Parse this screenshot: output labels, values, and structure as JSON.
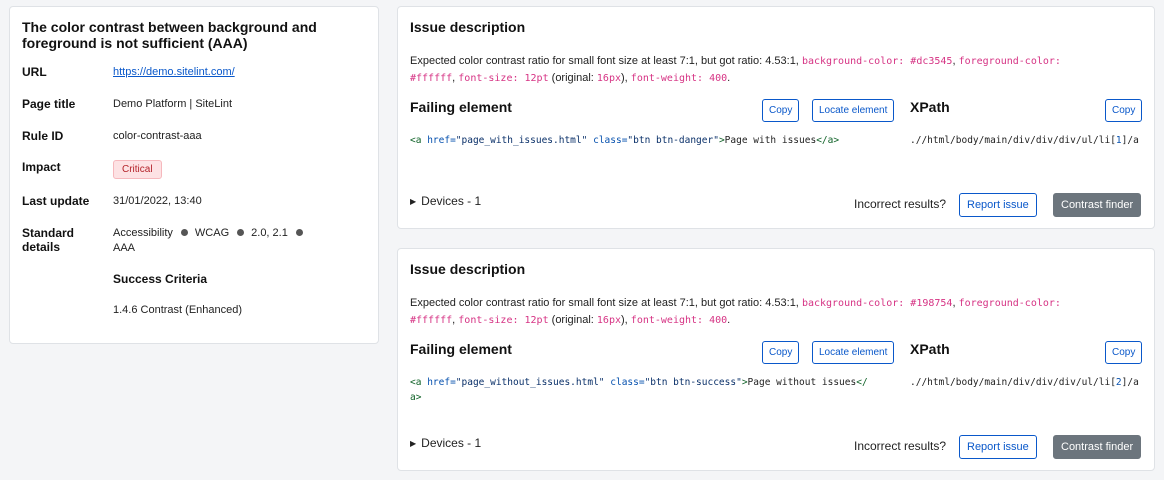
{
  "summary": {
    "title": "The color contrast between background and foreground is not sufficient (AAA)",
    "url_label": "URL",
    "url_value": "https://demo.sitelint.com/",
    "page_title_label": "Page title",
    "page_title_value": "Demo Platform | SiteLint",
    "rule_id_label": "Rule ID",
    "rule_id_value": "color-contrast-aaa",
    "impact_label": "Impact",
    "impact_value": "Critical",
    "last_update_label": "Last update",
    "last_update_value": "31/01/2022, 13:40",
    "standard_label": "Standard details",
    "standard_parts": [
      "Accessibility",
      "WCAG",
      "2.0, 2.1",
      "AAA"
    ],
    "success_criteria_label": "Success Criteria",
    "success_criteria_value": "1.4.6 Contrast (Enhanced)"
  },
  "issues": [
    {
      "heading": "Issue description",
      "desc_text1": "Expected color contrast ratio for small font size at least 7:1, but got ratio: 4.53:1,",
      "bg_code": "background-color: #dc3545",
      "fg_code": "foreground-color: #ffffff",
      "fs_code": "font-size: 12pt",
      "original_open": "(original:",
      "original_px": "16px",
      "original_close": "),",
      "fw_code": "font-weight: 400",
      "end_dot": ".",
      "failing_label": "Failing element",
      "copy_label": "Copy",
      "locate_label": "Locate element",
      "xpath_label": "XPath",
      "xpath_copy_label": "Copy",
      "code": {
        "open_tag": "<a",
        "href_attr": "href=",
        "href_val": "\"page_with_issues.html\"",
        "class_attr": "class=",
        "class_val": "\"btn btn-danger\"",
        "gt": ">",
        "text": "Page with issues",
        "close_tag": "</a>"
      },
      "xpath": {
        "prefix": ".//html/body/main/div/div/div/ul/li",
        "bracket_open": "[",
        "index": "1",
        "bracket_close": "]",
        "suffix": "/a"
      },
      "devices": "Devices - 1",
      "incorrect": "Incorrect results?",
      "report": "Report issue",
      "contrast_finder": "Contrast finder"
    },
    {
      "heading": "Issue description",
      "desc_text1": "Expected color contrast ratio for small font size at least 7:1, but got ratio: 4.53:1,",
      "bg_code": "background-color: #198754",
      "fg_code": "foreground-color: #ffffff",
      "fs_code": "font-size: 12pt",
      "original_open": "(original:",
      "original_px": "16px",
      "original_close": "),",
      "fw_code": "font-weight: 400",
      "end_dot": ".",
      "failing_label": "Failing element",
      "copy_label": "Copy",
      "locate_label": "Locate element",
      "xpath_label": "XPath",
      "xpath_copy_label": "Copy",
      "code": {
        "open_tag": "<a",
        "href_attr": "href=",
        "href_val": "\"page_without_issues.html\"",
        "class_attr": "class=",
        "class_val": "\"btn btn-success\"",
        "gt": ">",
        "text": "Page without issues",
        "close_tag": "</a>"
      },
      "xpath": {
        "prefix": ".//html/body/main/div/div/div/ul/li",
        "bracket_open": "[",
        "index": "2",
        "bracket_close": "]",
        "suffix": "/a"
      },
      "devices": "Devices - 1",
      "incorrect": "Incorrect results?",
      "report": "Report issue",
      "contrast_finder": "Contrast finder"
    }
  ],
  "colors": {
    "link": "#0a58ca",
    "code_pink": "#d63384",
    "badge_bg": "#fde2e4",
    "badge_text": "#b4232a",
    "btn_dark": "#6c757d"
  }
}
